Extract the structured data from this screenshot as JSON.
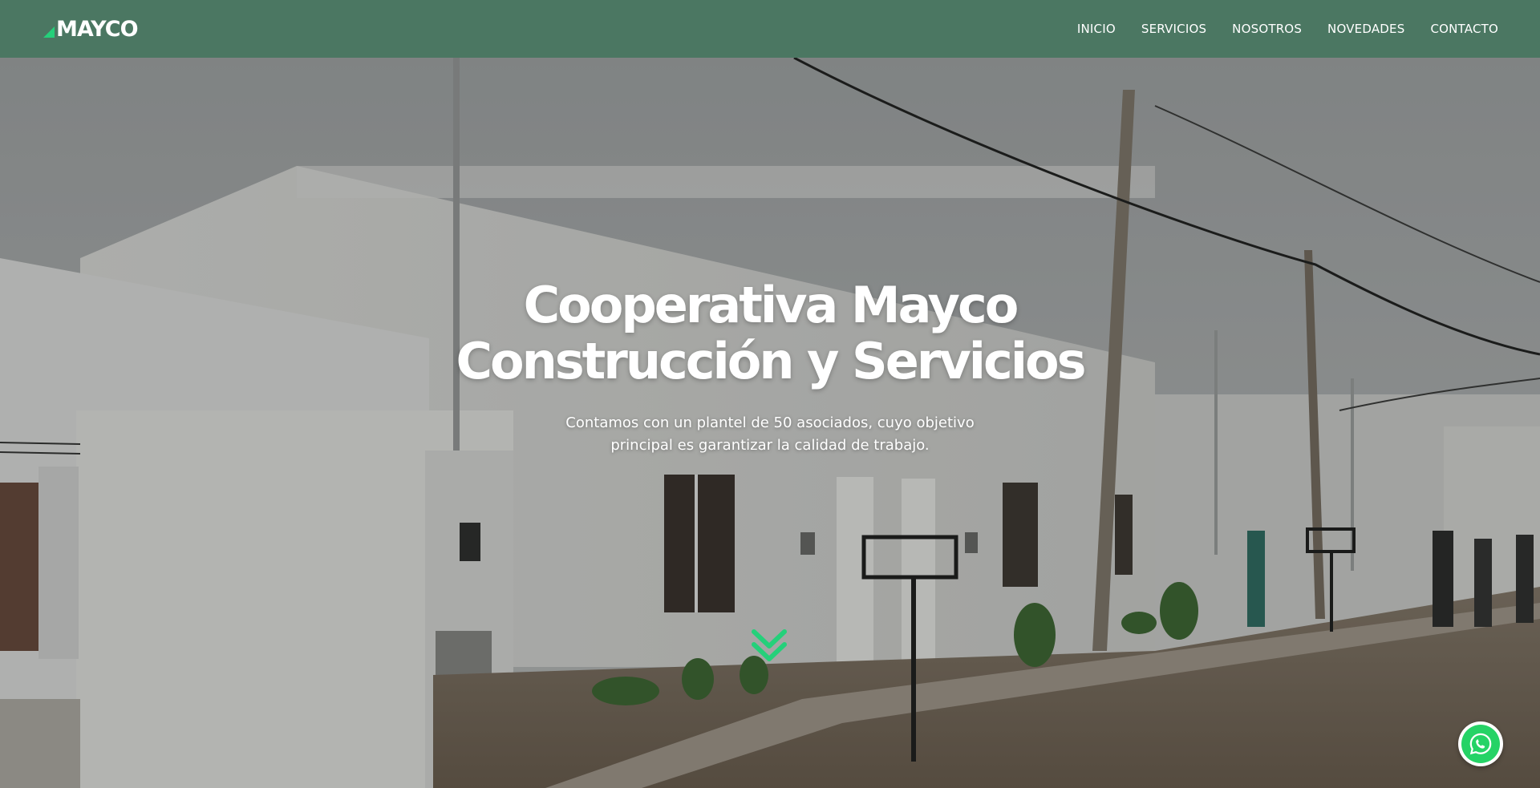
{
  "brand": {
    "name": "MAYCO",
    "accent": "#25d07a",
    "navbar_color": "#4b7762"
  },
  "nav": {
    "items": [
      "INICIO",
      "SERVICIOS",
      "NOSOTROS",
      "NOVEDADES",
      "CONTACTO"
    ]
  },
  "hero": {
    "title_line1": "Cooperativa Mayco",
    "title_line2": "Construcción y Servicios",
    "subtitle": "Contamos con un plantel de 50 asociados, cuyo objetivo principal es garantizar la calidad de trabajo.",
    "background_image": "construction-houses-photo",
    "scroll_icon": "double-chevron-down-icon"
  },
  "floating": {
    "whatsapp_icon": "whatsapp-icon",
    "whatsapp_color": "#25d366"
  }
}
